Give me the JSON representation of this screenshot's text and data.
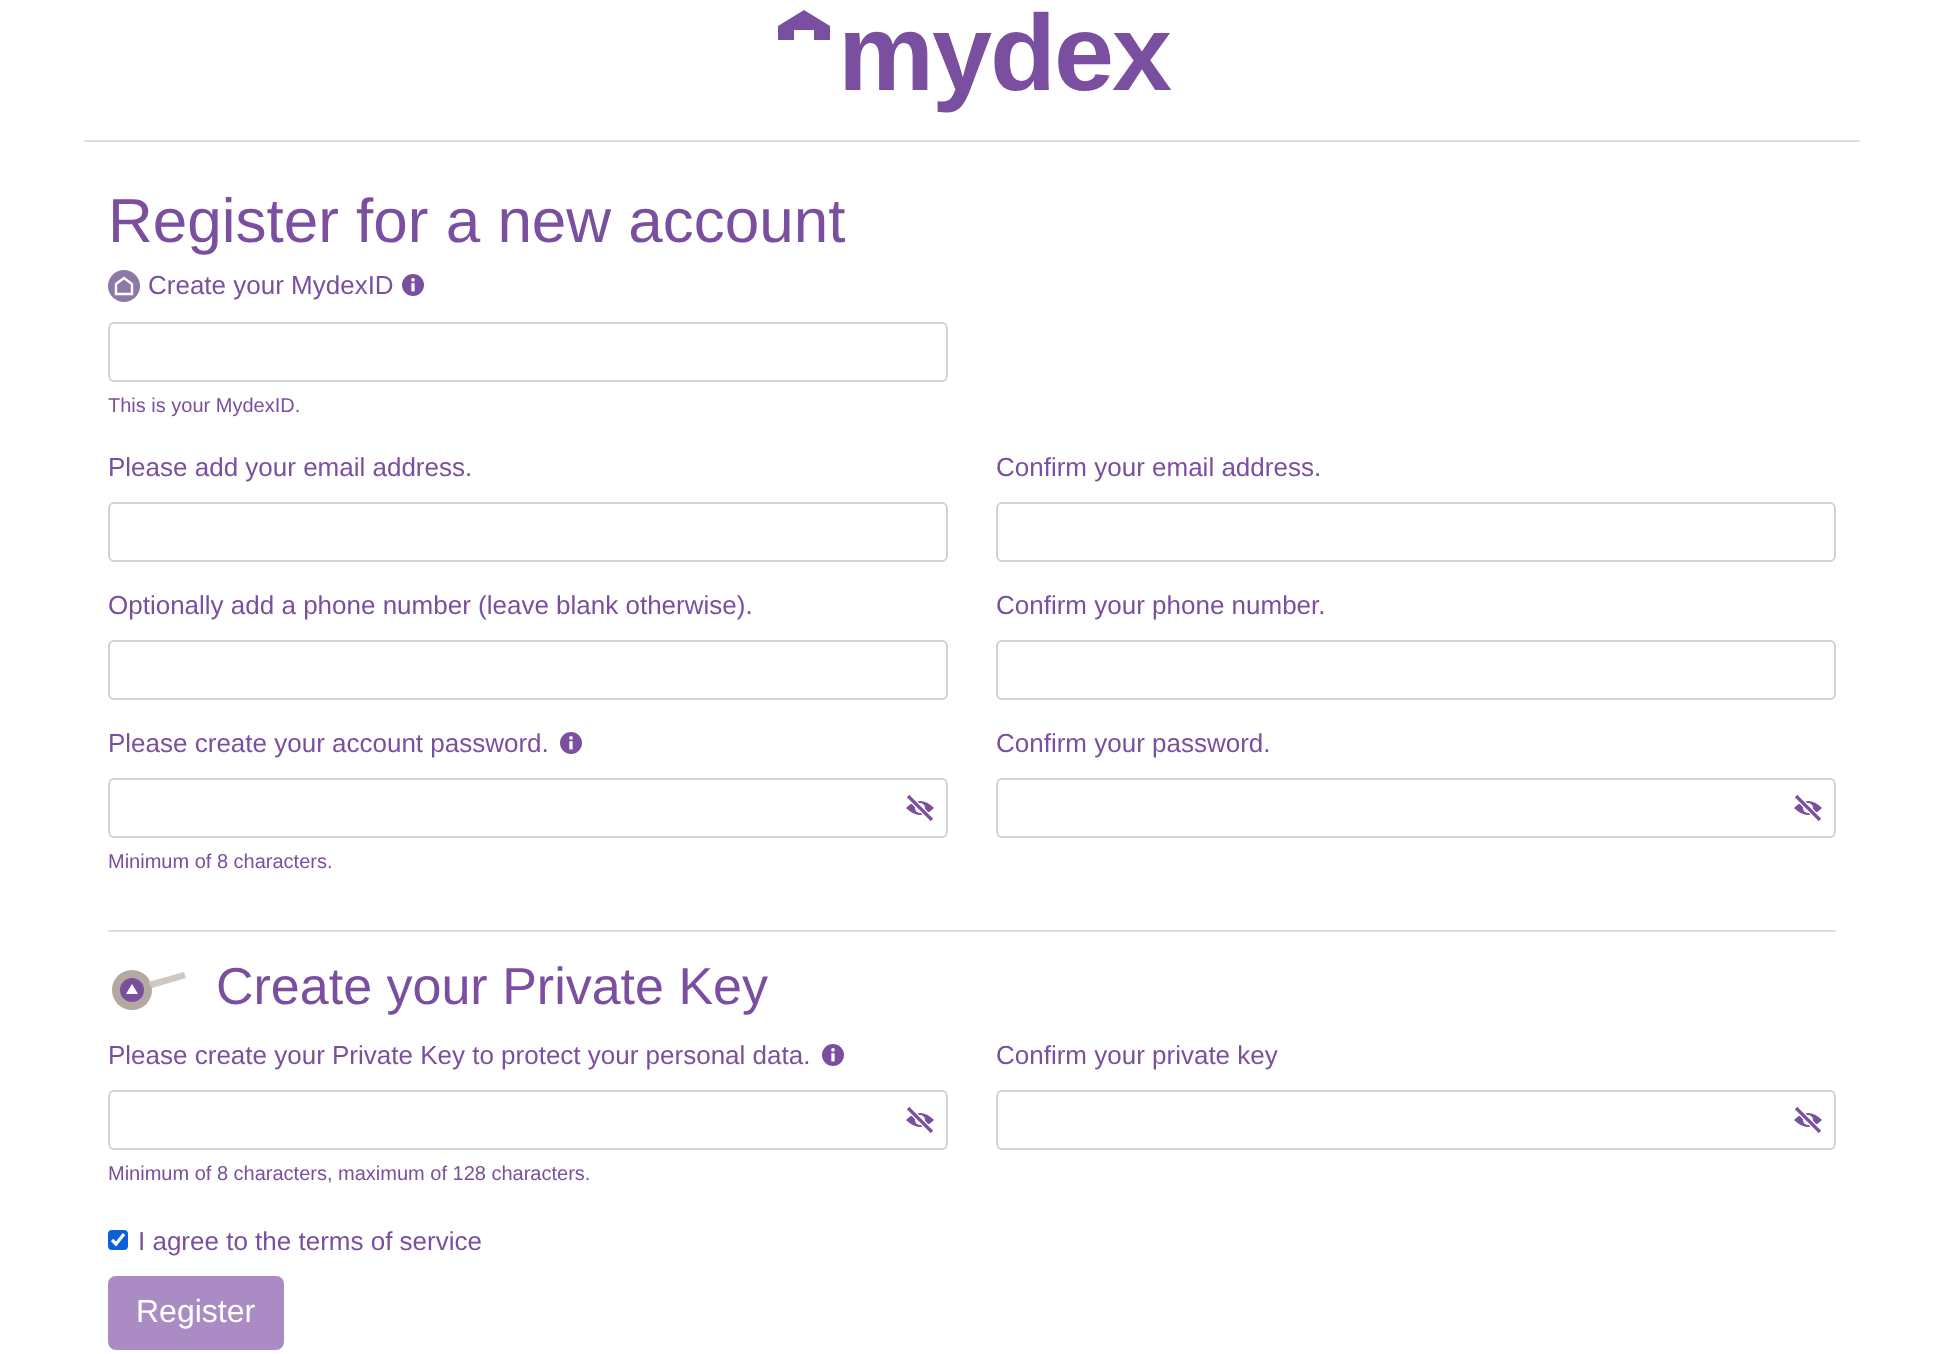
{
  "logo": {
    "text": "mydex"
  },
  "heading": "Register for a new account",
  "mydexid": {
    "label": "Create your MydexID",
    "info": true,
    "hint": "This is your MydexID."
  },
  "rows": [
    {
      "fields": [
        {
          "label": "Please add your email address.",
          "info": false,
          "kind": "text"
        },
        {
          "label": "Confirm your email address.",
          "info": false,
          "kind": "text"
        }
      ]
    },
    {
      "fields": [
        {
          "label": "Optionally add a phone number (leave blank otherwise).",
          "info": false,
          "kind": "text"
        },
        {
          "label": "Confirm your phone number.",
          "info": false,
          "kind": "text"
        }
      ]
    },
    {
      "fields": [
        {
          "label": "Please create your account password.",
          "info": true,
          "kind": "password",
          "hint": "Minimum of 8 characters."
        },
        {
          "label": "Confirm your password.",
          "info": false,
          "kind": "password"
        }
      ]
    }
  ],
  "private_key": {
    "heading": "Create your Private Key",
    "fields": [
      {
        "label": "Please create your Private Key to protect your personal data.",
        "info": true,
        "kind": "password",
        "hint": "Minimum of 8 characters, maximum of 128 characters."
      },
      {
        "label": "Confirm your private key",
        "info": false,
        "kind": "password"
      }
    ]
  },
  "terms": {
    "label": "I agree to the terms of service",
    "checked": true
  },
  "register_button": {
    "label": "Register"
  }
}
